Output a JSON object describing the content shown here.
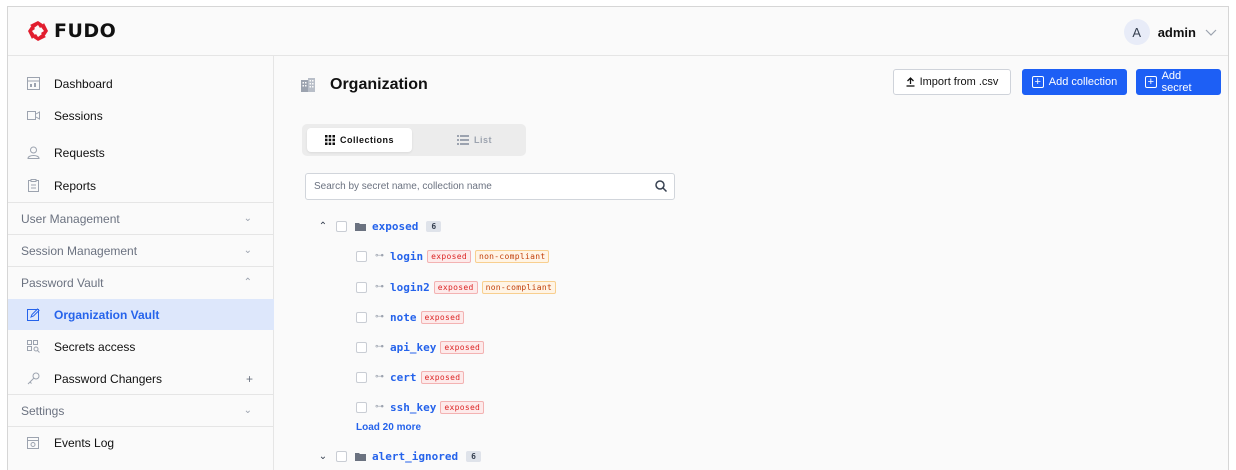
{
  "header": {
    "logo_text": "FUDO",
    "avatar_initial": "A",
    "user_name": "admin"
  },
  "sidebar": {
    "items": [
      {
        "label": "Dashboard",
        "icon": "dashboard-icon"
      },
      {
        "label": "Sessions",
        "icon": "video-icon"
      },
      {
        "label": "Requests",
        "icon": "user-icon"
      },
      {
        "label": "Reports",
        "icon": "clipboard-icon"
      }
    ],
    "sections": [
      {
        "label": "User Management",
        "expanded": false
      },
      {
        "label": "Session Management",
        "expanded": false
      },
      {
        "label": "Password Vault",
        "expanded": true
      },
      {
        "label": "Settings",
        "expanded": false
      }
    ],
    "vault_items": [
      {
        "label": "Organization Vault",
        "icon": "edit-icon",
        "active": true
      },
      {
        "label": "Secrets access",
        "icon": "grid-key-icon",
        "active": false
      },
      {
        "label": "Password Changers",
        "icon": "key-icon",
        "active": false,
        "suffix": "+"
      }
    ],
    "settings_items": [
      {
        "label": "Events Log",
        "icon": "calendar-icon"
      }
    ]
  },
  "main": {
    "title": "Organization",
    "title_icon": "building-icon",
    "buttons": {
      "import": "Import from .csv",
      "add_collection": "Add collection",
      "add_secret": "Add secret"
    },
    "view_toggle": {
      "collections": "Collections",
      "list": "List",
      "selected": "Collections"
    },
    "search": {
      "placeholder": "Search by secret name, collection name",
      "value": ""
    },
    "collections": [
      {
        "name": "exposed",
        "count": "6",
        "expanded": true,
        "secrets": [
          {
            "name": "login",
            "tags": [
              "exposed",
              "non-compliant"
            ]
          },
          {
            "name": "login2",
            "tags": [
              "exposed",
              "non-compliant"
            ]
          },
          {
            "name": "note",
            "tags": [
              "exposed"
            ]
          },
          {
            "name": "api_key",
            "tags": [
              "exposed"
            ]
          },
          {
            "name": "cert",
            "tags": [
              "exposed"
            ]
          },
          {
            "name": "ssh_key",
            "tags": [
              "exposed"
            ]
          }
        ],
        "load_more": "Load 20 more"
      },
      {
        "name": "alert_ignored",
        "count": "6",
        "expanded": false
      }
    ]
  },
  "colors": {
    "accent": "#1d5ff5",
    "link": "#2563eb",
    "active_bg": "#dde7fb",
    "exposed": "#dc2626",
    "non_compliant": "#c2410c",
    "logo_red": "#e11d2e"
  }
}
